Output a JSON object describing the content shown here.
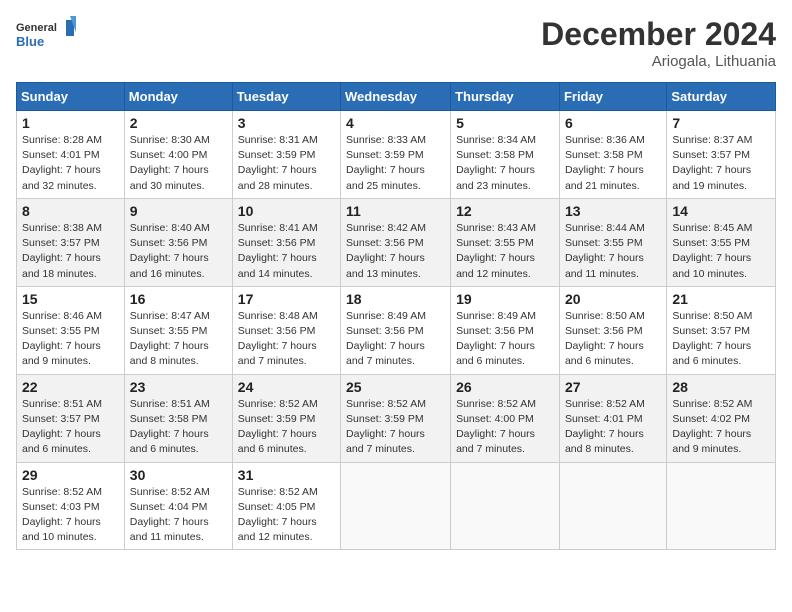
{
  "header": {
    "logo_line1": "General",
    "logo_line2": "Blue",
    "month": "December 2024",
    "location": "Ariogala, Lithuania"
  },
  "weekdays": [
    "Sunday",
    "Monday",
    "Tuesday",
    "Wednesday",
    "Thursday",
    "Friday",
    "Saturday"
  ],
  "weeks": [
    [
      {
        "day": "1",
        "sunrise": "8:28 AM",
        "sunset": "4:01 PM",
        "daylight": "7 hours and 32 minutes."
      },
      {
        "day": "2",
        "sunrise": "8:30 AM",
        "sunset": "4:00 PM",
        "daylight": "7 hours and 30 minutes."
      },
      {
        "day": "3",
        "sunrise": "8:31 AM",
        "sunset": "3:59 PM",
        "daylight": "7 hours and 28 minutes."
      },
      {
        "day": "4",
        "sunrise": "8:33 AM",
        "sunset": "3:59 PM",
        "daylight": "7 hours and 25 minutes."
      },
      {
        "day": "5",
        "sunrise": "8:34 AM",
        "sunset": "3:58 PM",
        "daylight": "7 hours and 23 minutes."
      },
      {
        "day": "6",
        "sunrise": "8:36 AM",
        "sunset": "3:58 PM",
        "daylight": "7 hours and 21 minutes."
      },
      {
        "day": "7",
        "sunrise": "8:37 AM",
        "sunset": "3:57 PM",
        "daylight": "7 hours and 19 minutes."
      }
    ],
    [
      {
        "day": "8",
        "sunrise": "8:38 AM",
        "sunset": "3:57 PM",
        "daylight": "7 hours and 18 minutes."
      },
      {
        "day": "9",
        "sunrise": "8:40 AM",
        "sunset": "3:56 PM",
        "daylight": "7 hours and 16 minutes."
      },
      {
        "day": "10",
        "sunrise": "8:41 AM",
        "sunset": "3:56 PM",
        "daylight": "7 hours and 14 minutes."
      },
      {
        "day": "11",
        "sunrise": "8:42 AM",
        "sunset": "3:56 PM",
        "daylight": "7 hours and 13 minutes."
      },
      {
        "day": "12",
        "sunrise": "8:43 AM",
        "sunset": "3:55 PM",
        "daylight": "7 hours and 12 minutes."
      },
      {
        "day": "13",
        "sunrise": "8:44 AM",
        "sunset": "3:55 PM",
        "daylight": "7 hours and 11 minutes."
      },
      {
        "day": "14",
        "sunrise": "8:45 AM",
        "sunset": "3:55 PM",
        "daylight": "7 hours and 10 minutes."
      }
    ],
    [
      {
        "day": "15",
        "sunrise": "8:46 AM",
        "sunset": "3:55 PM",
        "daylight": "7 hours and 9 minutes."
      },
      {
        "day": "16",
        "sunrise": "8:47 AM",
        "sunset": "3:55 PM",
        "daylight": "7 hours and 8 minutes."
      },
      {
        "day": "17",
        "sunrise": "8:48 AM",
        "sunset": "3:56 PM",
        "daylight": "7 hours and 7 minutes."
      },
      {
        "day": "18",
        "sunrise": "8:49 AM",
        "sunset": "3:56 PM",
        "daylight": "7 hours and 7 minutes."
      },
      {
        "day": "19",
        "sunrise": "8:49 AM",
        "sunset": "3:56 PM",
        "daylight": "7 hours and 6 minutes."
      },
      {
        "day": "20",
        "sunrise": "8:50 AM",
        "sunset": "3:56 PM",
        "daylight": "7 hours and 6 minutes."
      },
      {
        "day": "21",
        "sunrise": "8:50 AM",
        "sunset": "3:57 PM",
        "daylight": "7 hours and 6 minutes."
      }
    ],
    [
      {
        "day": "22",
        "sunrise": "8:51 AM",
        "sunset": "3:57 PM",
        "daylight": "7 hours and 6 minutes."
      },
      {
        "day": "23",
        "sunrise": "8:51 AM",
        "sunset": "3:58 PM",
        "daylight": "7 hours and 6 minutes."
      },
      {
        "day": "24",
        "sunrise": "8:52 AM",
        "sunset": "3:59 PM",
        "daylight": "7 hours and 6 minutes."
      },
      {
        "day": "25",
        "sunrise": "8:52 AM",
        "sunset": "3:59 PM",
        "daylight": "7 hours and 7 minutes."
      },
      {
        "day": "26",
        "sunrise": "8:52 AM",
        "sunset": "4:00 PM",
        "daylight": "7 hours and 7 minutes."
      },
      {
        "day": "27",
        "sunrise": "8:52 AM",
        "sunset": "4:01 PM",
        "daylight": "7 hours and 8 minutes."
      },
      {
        "day": "28",
        "sunrise": "8:52 AM",
        "sunset": "4:02 PM",
        "daylight": "7 hours and 9 minutes."
      }
    ],
    [
      {
        "day": "29",
        "sunrise": "8:52 AM",
        "sunset": "4:03 PM",
        "daylight": "7 hours and 10 minutes."
      },
      {
        "day": "30",
        "sunrise": "8:52 AM",
        "sunset": "4:04 PM",
        "daylight": "7 hours and 11 minutes."
      },
      {
        "day": "31",
        "sunrise": "8:52 AM",
        "sunset": "4:05 PM",
        "daylight": "7 hours and 12 minutes."
      },
      null,
      null,
      null,
      null
    ]
  ]
}
